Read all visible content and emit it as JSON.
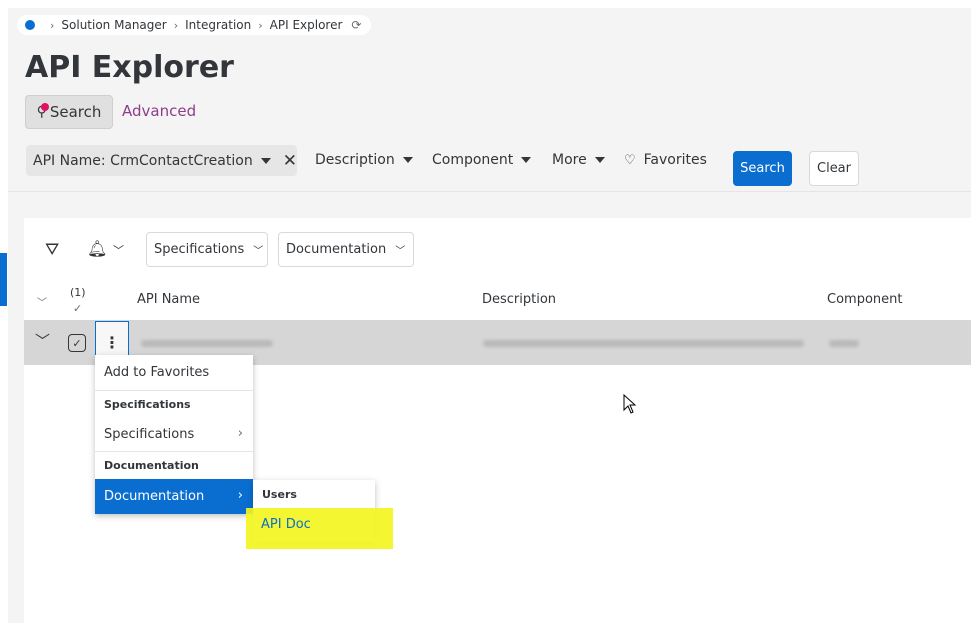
{
  "breadcrumb": {
    "items": [
      "Solution Manager",
      "Integration",
      "API Explorer"
    ]
  },
  "page": {
    "title": "API Explorer"
  },
  "search_modes": {
    "search_label": "Search",
    "advanced_label": "Advanced"
  },
  "filters": {
    "active_chip": "API Name: CrmContactCreation",
    "description": "Description",
    "component": "Component",
    "more": "More",
    "favorites": "Favorites",
    "search_button": "Search",
    "clear_button": "Clear"
  },
  "toolbar": {
    "specifications_dropdown": "Specifications",
    "documentation_dropdown": "Documentation"
  },
  "table": {
    "selected_count": "(1)",
    "columns": [
      "API Name",
      "Description",
      "Component"
    ]
  },
  "context_menu": {
    "add_favorites": "Add to Favorites",
    "group_specifications": "Specifications",
    "specifications": "Specifications",
    "group_documentation": "Documentation",
    "documentation": "Documentation"
  },
  "submenu": {
    "group_users": "Users",
    "api_doc": "API Doc"
  },
  "colors": {
    "accent": "#0a6ed1",
    "highlight": "#f2f51e",
    "advanced_link": "#8e3d8c"
  }
}
